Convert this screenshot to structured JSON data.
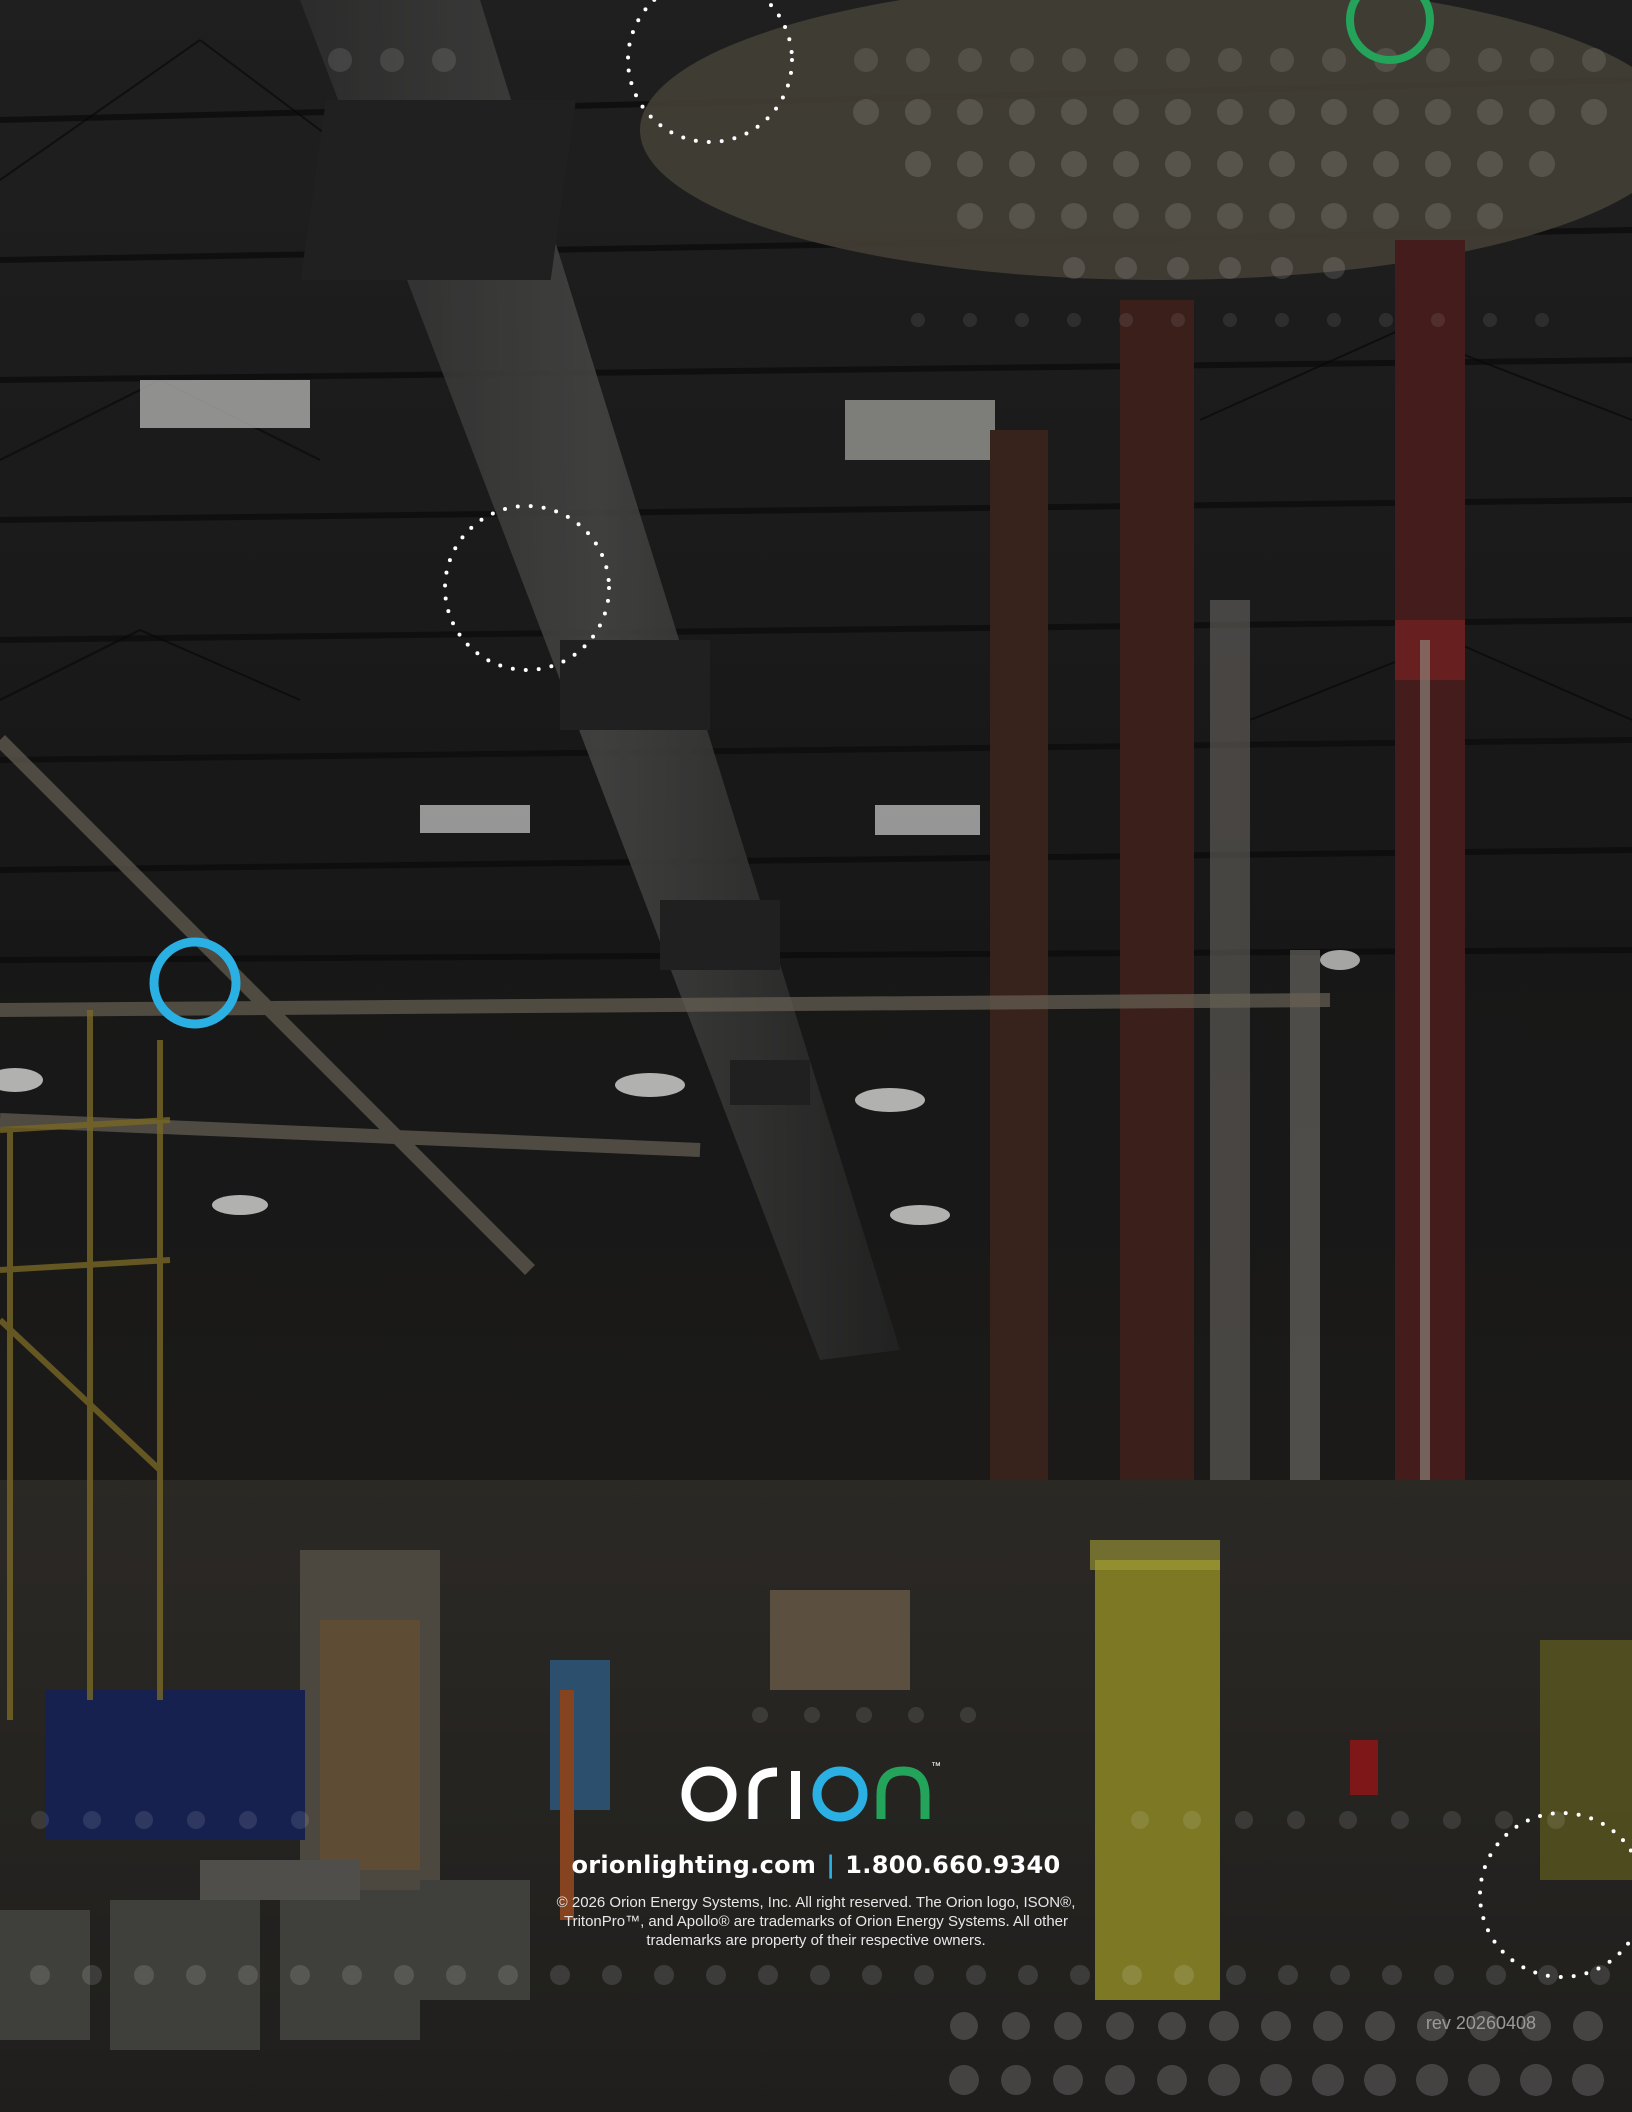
{
  "brand": {
    "logo_text": "orion",
    "logo_letters_white": "or",
    "logo_letter_i": "i",
    "logo_letters_green": "n",
    "logo_letter_o2": "o",
    "trademark": "™"
  },
  "contact": {
    "website": "orionlighting.com",
    "separator": "|",
    "phone": "1.800.660.9340"
  },
  "legal": "© 2026 Orion Energy Systems, Inc. All right reserved. The Orion logo, ISON®, TritonPro™, and Apollo® are trademarks of Orion Energy Systems. All other trademarks are property of their respective owners.",
  "revision": "rev 20260408",
  "colors": {
    "brand_blue": "#2bb0e3",
    "brand_green": "#23a45a",
    "text_white": "#ffffff",
    "rev_gray": "#9a9a9a"
  },
  "decorations": [
    "blue-ring-icon",
    "green-ring-icon",
    "dotted-circle-icon"
  ]
}
